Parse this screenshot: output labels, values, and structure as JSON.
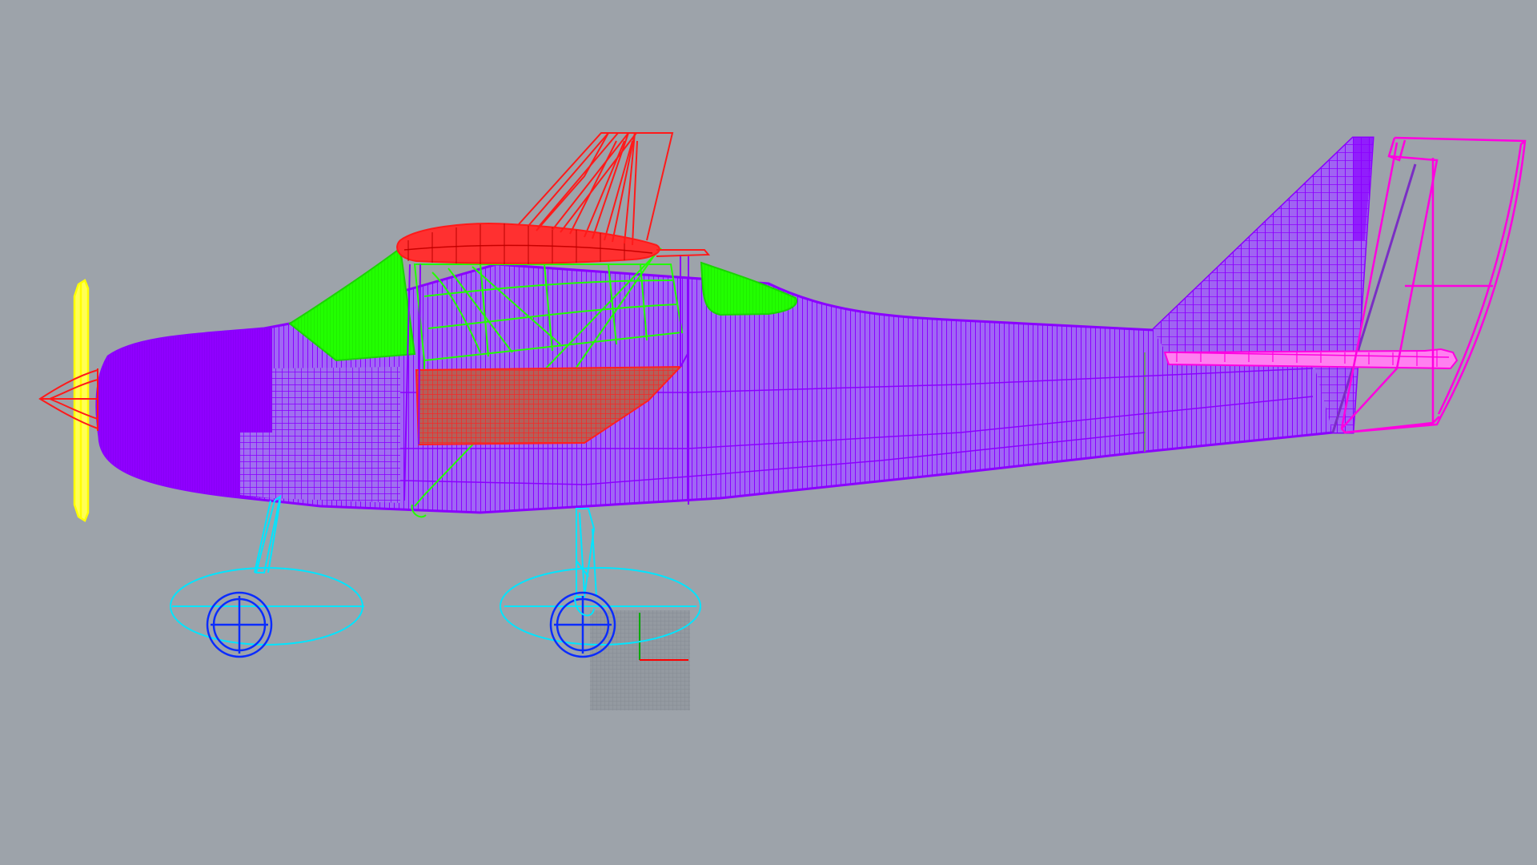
{
  "viewport": {
    "view": "right",
    "display_mode": "wireframe",
    "background": "#9da3aa"
  },
  "layers": {
    "fuselage": {
      "color": "#9b00ff"
    },
    "windows": {
      "color": "#22ff00"
    },
    "wing": {
      "color": "#ff1a1a"
    },
    "tail": {
      "color": "#ff00e0"
    },
    "propeller": {
      "color": "#ffff00"
    },
    "spinner": {
      "color": "#ff1a1a"
    },
    "landing_gear": {
      "color": "#00e5ff"
    },
    "wheels": {
      "color": "#0b2cff"
    },
    "cpl_grid": {
      "color": "#8e949b"
    },
    "axis_x": {
      "color": "#ff0000"
    },
    "axis_y": {
      "color": "#00aa00"
    }
  }
}
